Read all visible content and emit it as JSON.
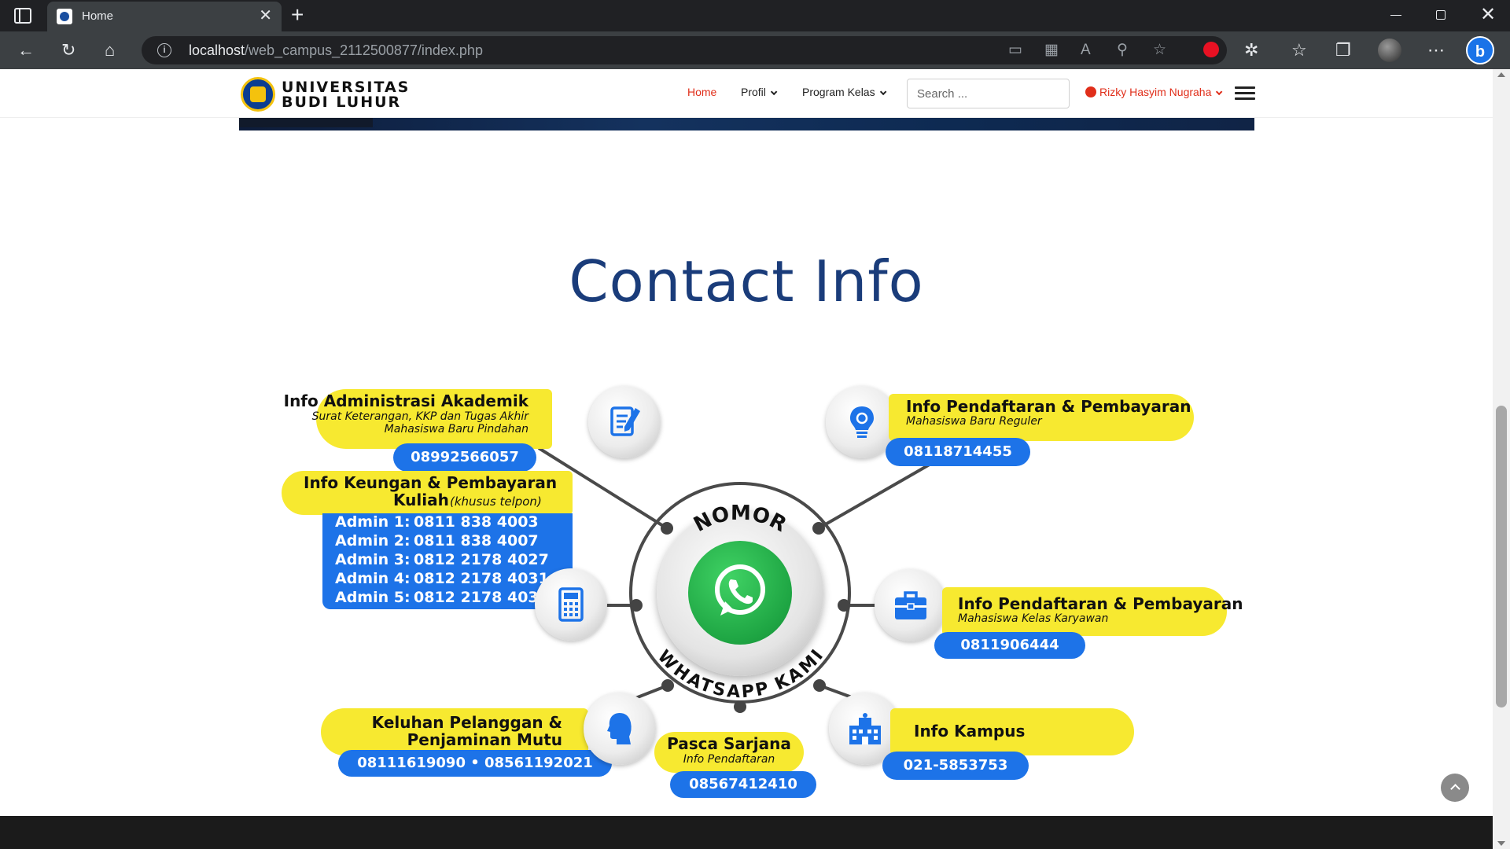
{
  "browser": {
    "tab_title": "Home",
    "url_host": "localhost",
    "url_path": "/web_campus_2112500877/index.php"
  },
  "site": {
    "logo_line1": "UNIVERSITAS",
    "logo_line2": "BUDI LUHUR",
    "nav": {
      "home": "Home",
      "profil": "Profil",
      "program_kelas": "Program Kelas"
    },
    "search_placeholder": "Search ...",
    "user_name": "Rizky Hasyim Nugraha"
  },
  "section": {
    "title": "Contact Info"
  },
  "infographic": {
    "hub_top": "NOMOR",
    "hub_bottom": "WHATSAPP KAMI",
    "akademik": {
      "title": "Info Administrasi Akademik",
      "sub1": "Surat Keterangan, KKP dan Tugas Akhir",
      "sub2": "Mahasiswa Baru Pindahan",
      "phone": "08992566057"
    },
    "keuangan": {
      "title1": "Info Keungan & Pembayaran",
      "title2": "Kuliah",
      "note": "(khusus telpon)",
      "admins": [
        {
          "label": "Admin 1:",
          "phone": "0811 838 4003"
        },
        {
          "label": "Admin 2:",
          "phone": "0811 838 4007"
        },
        {
          "label": "Admin 3:",
          "phone": "0812 2178 4027"
        },
        {
          "label": "Admin 4:",
          "phone": "0812 2178 4031"
        },
        {
          "label": "Admin 5:",
          "phone": "0812 2178 4033"
        }
      ]
    },
    "keluhan": {
      "title1": "Keluhan Pelanggan &",
      "title2": "Penjaminan Mutu",
      "phone": "08111619090 • 08561192021"
    },
    "pasca": {
      "title": "Pasca Sarjana",
      "sub": "Info Pendaftaran",
      "phone": "08567412410"
    },
    "reguler": {
      "title": "Info Pendaftaran & Pembayaran",
      "sub": "Mahasiswa Baru Reguler",
      "phone": "08118714455"
    },
    "karyawan": {
      "title": "Info Pendaftaran & Pembayaran",
      "sub": "Mahasiswa Kelas Karyawan",
      "phone": "0811906444"
    },
    "kampus": {
      "title": "Info Kampus",
      "phone": "021-5853753"
    }
  },
  "colors": {
    "accent_yellow": "#f7e930",
    "accent_blue": "#1d73e8",
    "title_navy": "#1a3c7a",
    "nav_active": "#e02e1a",
    "whatsapp_green": "#25b14a"
  },
  "icons": {
    "akademik": "document-pen-icon",
    "keuangan": "calculator-icon",
    "keluhan": "person-head-icon",
    "reguler": "lightbulb-icon",
    "karyawan": "briefcase-icon",
    "kampus": "building-icon",
    "hub": "whatsapp-icon"
  }
}
